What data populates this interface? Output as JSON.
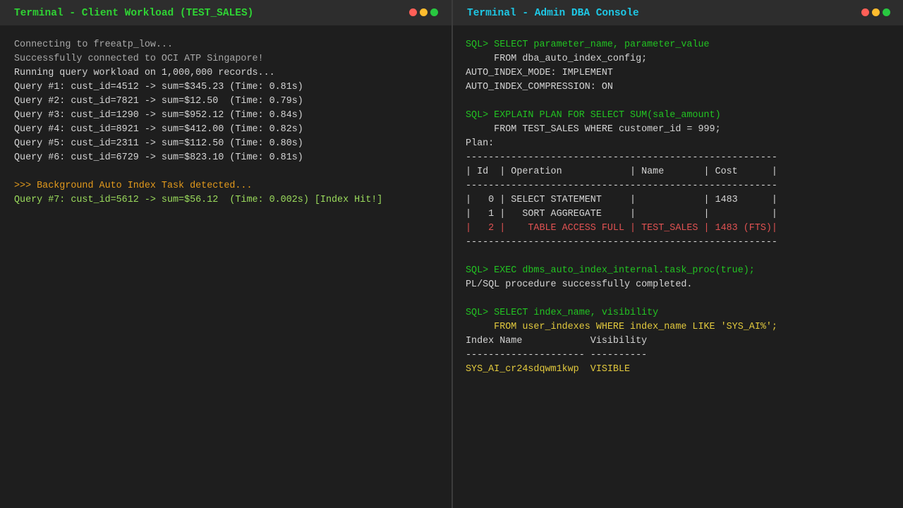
{
  "left": {
    "title": "Terminal - Client Workload (TEST_SALES)",
    "lines": [
      {
        "text": "Connecting to freeatp_low...",
        "color": "gray"
      },
      {
        "text": "Successfully connected to OCI ATP Singapore!",
        "color": "gray"
      },
      {
        "text": "Running query workload on 1,000,000 records...",
        "color": "white"
      },
      {
        "text": "Query #1: cust_id=4512 -> sum=$345.23 (Time: 0.81s)",
        "color": "white"
      },
      {
        "text": "Query #2: cust_id=7821 -> sum=$12.50  (Time: 0.79s)",
        "color": "white"
      },
      {
        "text": "Query #3: cust_id=1290 -> sum=$952.12 (Time: 0.84s)",
        "color": "white"
      },
      {
        "text": "Query #4: cust_id=8921 -> sum=$412.00 (Time: 0.82s)",
        "color": "white"
      },
      {
        "text": "Query #5: cust_id=2311 -> sum=$112.50 (Time: 0.80s)",
        "color": "white"
      },
      {
        "text": "Query #6: cust_id=6729 -> sum=$823.10 (Time: 0.81s)",
        "color": "white"
      },
      {
        "text": "",
        "color": "white"
      },
      {
        "text": ">>> Background Auto Index Task detected...",
        "color": "orange"
      },
      {
        "text": "Query #7: cust_id=5612 -> sum=$56.12  (Time: 0.002s) [Index Hit!]",
        "color": "lightgreen"
      }
    ]
  },
  "right": {
    "title": "Terminal - Admin DBA Console",
    "lines": [
      {
        "text": "SQL> SELECT parameter_name, parameter_value",
        "color": "green"
      },
      {
        "text": "     FROM dba_auto_index_config;",
        "color": "white"
      },
      {
        "text": "AUTO_INDEX_MODE: IMPLEMENT",
        "color": "white"
      },
      {
        "text": "AUTO_INDEX_COMPRESSION: ON",
        "color": "white"
      },
      {
        "text": "",
        "color": "white"
      },
      {
        "text": "SQL> EXPLAIN PLAN FOR SELECT SUM(sale_amount)",
        "color": "green"
      },
      {
        "text": "     FROM TEST_SALES WHERE customer_id = 999;",
        "color": "white"
      },
      {
        "text": "Plan:",
        "color": "white"
      },
      {
        "text": "-------------------------------------------------------",
        "color": "white"
      },
      {
        "text": "| Id  | Operation            | Name       | Cost      |",
        "color": "white"
      },
      {
        "text": "-------------------------------------------------------",
        "color": "white"
      },
      {
        "text": "|   0 | SELECT STATEMENT     |            | 1483      |",
        "color": "white"
      },
      {
        "text": "|   1 |   SORT AGGREGATE     |            |           |",
        "color": "white"
      },
      {
        "text": "|   2 |    TABLE ACCESS FULL | TEST_SALES | 1483 (FTS)|",
        "color": "red"
      },
      {
        "text": "-------------------------------------------------------",
        "color": "white"
      },
      {
        "text": "",
        "color": "white"
      },
      {
        "text": "SQL> EXEC dbms_auto_index_internal.task_proc(true);",
        "color": "green"
      },
      {
        "text": "PL/SQL procedure successfully completed.",
        "color": "white"
      },
      {
        "text": "",
        "color": "white"
      },
      {
        "text": "SQL> SELECT index_name, visibility",
        "color": "green"
      },
      {
        "text": "     FROM user_indexes WHERE index_name LIKE 'SYS_AI%';",
        "color": "yellow"
      },
      {
        "text": "Index Name            Visibility",
        "color": "white"
      },
      {
        "text": "--------------------- ----------",
        "color": "white"
      },
      {
        "text": "SYS_AI_cr24sdqwm1kwp  VISIBLE",
        "color": "yellow"
      }
    ]
  }
}
